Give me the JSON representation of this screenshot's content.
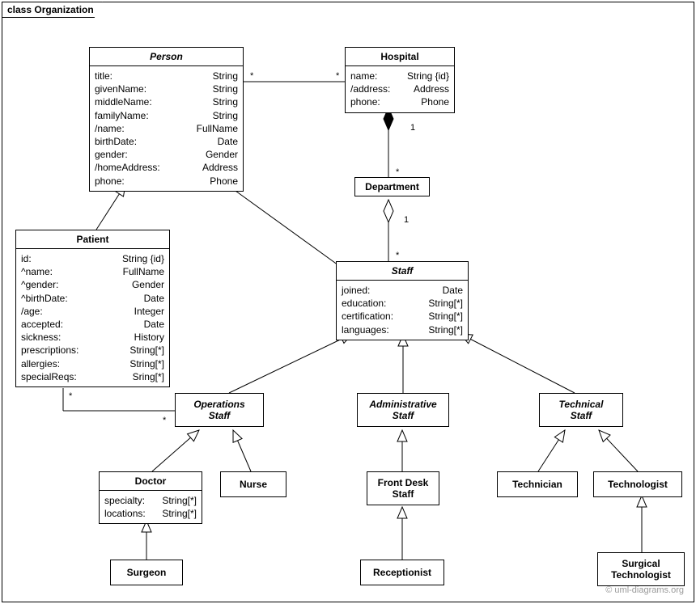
{
  "frame": {
    "title": "class Organization"
  },
  "watermark": "© uml-diagrams.org",
  "classes": {
    "person": {
      "name": "Person",
      "attrs": [
        {
          "n": "title:",
          "t": "String"
        },
        {
          "n": "givenName:",
          "t": "String"
        },
        {
          "n": "middleName:",
          "t": "String"
        },
        {
          "n": "familyName:",
          "t": "String"
        },
        {
          "n": "/name:",
          "t": "FullName"
        },
        {
          "n": "birthDate:",
          "t": "Date"
        },
        {
          "n": "gender:",
          "t": "Gender"
        },
        {
          "n": "/homeAddress:",
          "t": "Address"
        },
        {
          "n": "phone:",
          "t": "Phone"
        }
      ]
    },
    "hospital": {
      "name": "Hospital",
      "attrs": [
        {
          "n": "name:",
          "t": "String {id}"
        },
        {
          "n": "/address:",
          "t": "Address"
        },
        {
          "n": "phone:",
          "t": "Phone"
        }
      ]
    },
    "department": {
      "name": "Department"
    },
    "patient": {
      "name": "Patient",
      "attrs": [
        {
          "n": "id:",
          "t": "String {id}"
        },
        {
          "n": "^name:",
          "t": "FullName"
        },
        {
          "n": "^gender:",
          "t": "Gender"
        },
        {
          "n": "^birthDate:",
          "t": "Date"
        },
        {
          "n": "/age:",
          "t": "Integer"
        },
        {
          "n": "accepted:",
          "t": "Date"
        },
        {
          "n": "sickness:",
          "t": "History"
        },
        {
          "n": "prescriptions:",
          "t": "String[*]"
        },
        {
          "n": "allergies:",
          "t": "String[*]"
        },
        {
          "n": "specialReqs:",
          "t": "Sring[*]"
        }
      ]
    },
    "staff": {
      "name": "Staff",
      "attrs": [
        {
          "n": "joined:",
          "t": "Date"
        },
        {
          "n": "education:",
          "t": "String[*]"
        },
        {
          "n": "certification:",
          "t": "String[*]"
        },
        {
          "n": "languages:",
          "t": "String[*]"
        }
      ]
    },
    "operationsStaff": {
      "name_l1": "Operations",
      "name_l2": "Staff"
    },
    "administrativeStaff": {
      "name_l1": "Administrative",
      "name_l2": "Staff"
    },
    "technicalStaff": {
      "name_l1": "Technical",
      "name_l2": "Staff"
    },
    "doctor": {
      "name": "Doctor",
      "attrs": [
        {
          "n": "specialty:",
          "t": "String[*]"
        },
        {
          "n": "locations:",
          "t": "String[*]"
        }
      ]
    },
    "nurse": {
      "name": "Nurse"
    },
    "frontDeskStaff": {
      "name_l1": "Front Desk",
      "name_l2": "Staff"
    },
    "technician": {
      "name": "Technician"
    },
    "technologist": {
      "name": "Technologist"
    },
    "surgeon": {
      "name": "Surgeon"
    },
    "receptionist": {
      "name": "Receptionist"
    },
    "surgicalTechnologist": {
      "name_l1": "Surgical",
      "name_l2": "Technologist"
    }
  },
  "mults": {
    "person_hospital_left": "*",
    "person_hospital_right": "*",
    "hospital_dept_top": "1",
    "hospital_dept_bottom": "*",
    "dept_staff_top": "1",
    "dept_staff_bottom": "*",
    "patient_ops_left": "*",
    "patient_ops_right": "*"
  }
}
